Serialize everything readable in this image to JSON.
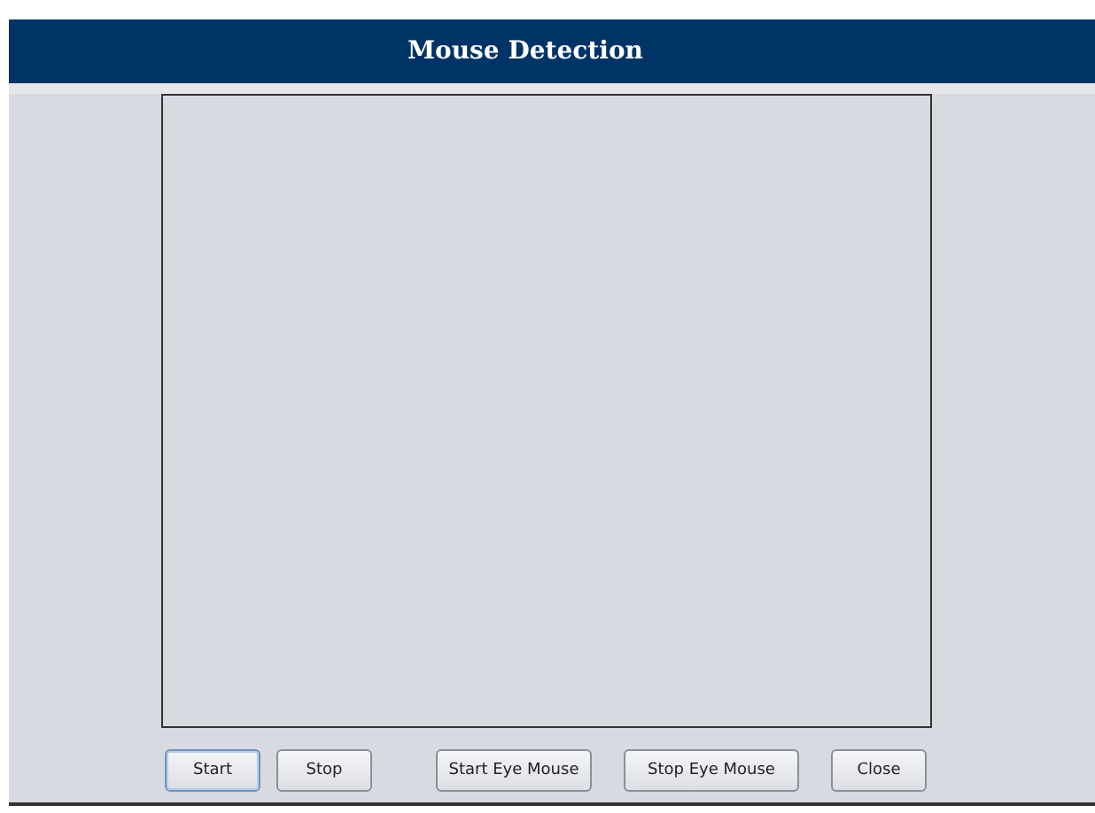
{
  "window": {
    "title": "Mouse Detection"
  },
  "buttons": [
    {
      "label": "Start",
      "focused": true
    },
    {
      "label": "Stop",
      "focused": false
    },
    {
      "label": "Start Eye Mouse",
      "focused": false
    },
    {
      "label": "Stop Eye Mouse",
      "focused": false
    },
    {
      "label": "Close",
      "focused": false
    }
  ]
}
